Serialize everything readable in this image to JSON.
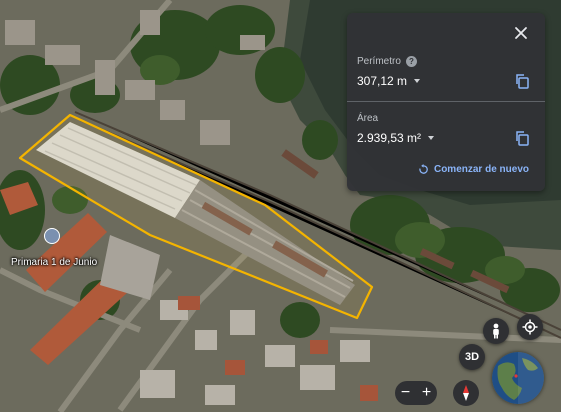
{
  "measure_panel": {
    "perimeter_label": "Perímetro",
    "perimeter_help": "?",
    "perimeter_value": "307,12 m",
    "area_label": "Área",
    "area_value": "2.939,53 m²",
    "restart_label": "Comenzar de nuevo"
  },
  "map": {
    "place_label": "Primaria 1 de Junio",
    "outline_color": "#f4b400"
  },
  "controls": {
    "view_3d_label": "3D",
    "zoom_out": "−",
    "zoom_in": "+"
  },
  "icons": [
    "close-icon",
    "help-icon",
    "copy-icon",
    "restart-icon",
    "pegman-icon",
    "my-location-icon",
    "compass-icon",
    "globe-icon"
  ]
}
